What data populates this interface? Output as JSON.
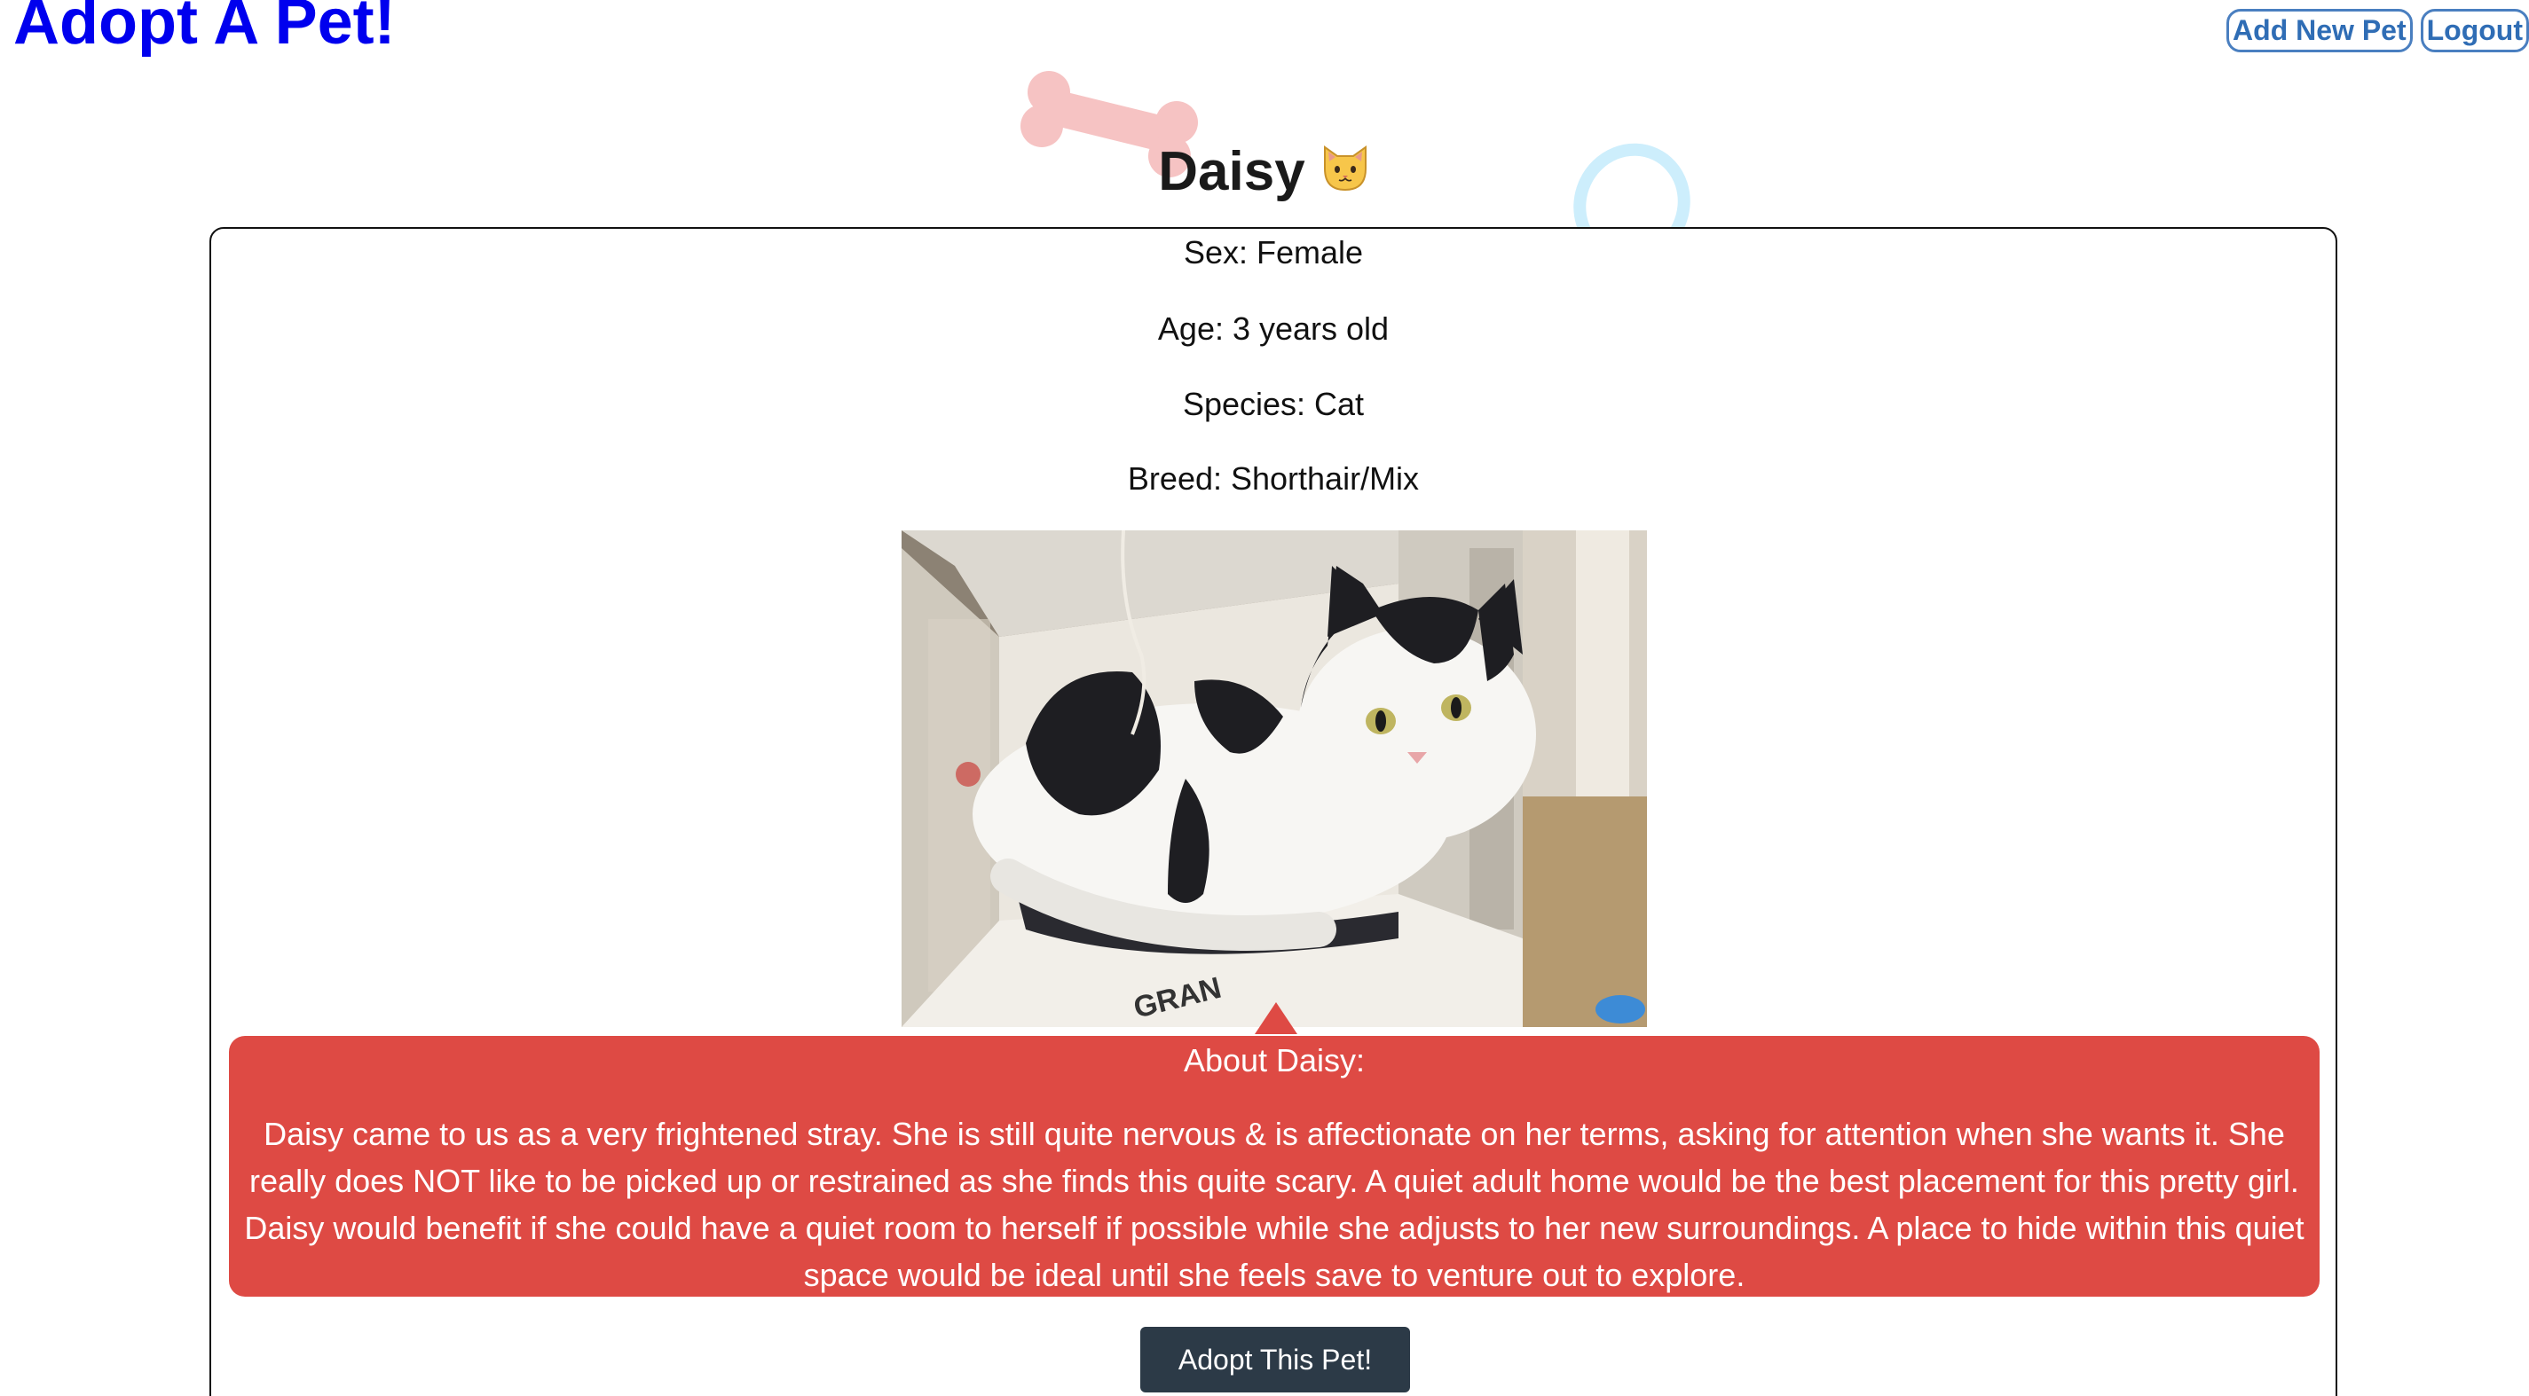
{
  "header": {
    "brand": "Adopt A Pet!",
    "nav": {
      "add_new_pet": "Add New Pet",
      "logout": "Logout"
    }
  },
  "pet": {
    "name": "Daisy",
    "species_icon": "cat-face-icon",
    "sex": "Sex: Female",
    "age": "Age: 3 years old",
    "species": "Species: Cat",
    "breed": "Breed: Shorthair/Mix",
    "about_heading": "About Daisy:",
    "about_text": "Daisy came to us as a very frightened stray. She is still quite nervous & is affectionate on her terms, asking for attention when she wants it. She really does NOT like to be picked up or restrained as she finds this quite scary. A quiet adult home would be the best placement for this pretty girl. Daisy would benefit if she could have a quiet room to herself if possible while she adjusts to her new surroundings. A place to hide within this quiet space would be ideal until she feels save to venture out to explore.",
    "photo_box_text": "GRAN",
    "adopt_button": "Adopt This Pet!"
  },
  "decorations": {
    "bone_icon": "bone-icon",
    "ring_icon": "ring-icon"
  },
  "colors": {
    "brand": "#0000ee",
    "nav_border": "#4a7fc0",
    "about_bg": "#de4a44",
    "button_bg": "#2c3a47",
    "bone": "#f6c3c3",
    "ring": "#cdeefc"
  }
}
